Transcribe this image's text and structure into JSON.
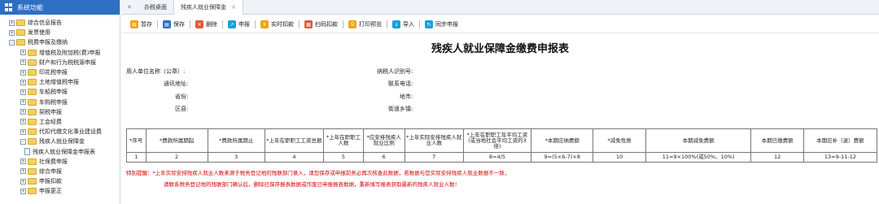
{
  "sidebar": {
    "title": "系统功能",
    "items": [
      {
        "label": "综合信息报告",
        "level": 0,
        "toggle": "+",
        "kind": "folder"
      },
      {
        "label": "发票使用",
        "level": 0,
        "toggle": "+",
        "kind": "folder"
      },
      {
        "label": "税费申报及缴纳",
        "level": 0,
        "toggle": "-",
        "kind": "folder"
      },
      {
        "label": "增值税及附加税(费)申报",
        "level": 1,
        "toggle": "+",
        "kind": "folder"
      },
      {
        "label": "财产和行为税税源申报",
        "level": 1,
        "toggle": "+",
        "kind": "folder"
      },
      {
        "label": "印花税申报",
        "level": 1,
        "toggle": "+",
        "kind": "folder"
      },
      {
        "label": "土地增值税申报",
        "level": 1,
        "toggle": "+",
        "kind": "folder"
      },
      {
        "label": "车船税申报",
        "level": 1,
        "toggle": "+",
        "kind": "folder"
      },
      {
        "label": "车购税申报",
        "level": 1,
        "toggle": "+",
        "kind": "folder"
      },
      {
        "label": "契税申报",
        "level": 1,
        "toggle": "+",
        "kind": "folder"
      },
      {
        "label": "工会经费",
        "level": 1,
        "toggle": "+",
        "kind": "folder"
      },
      {
        "label": "代扣代缴文化事业建设费",
        "level": 1,
        "toggle": "+",
        "kind": "folder"
      },
      {
        "label": "残疾人就业保障金",
        "level": 1,
        "toggle": "-",
        "kind": "folder"
      },
      {
        "label": "残疾人就业保障金申报表",
        "level": 2,
        "toggle": "",
        "kind": "doc"
      },
      {
        "label": "社保费申报",
        "level": 1,
        "toggle": "+",
        "kind": "folder"
      },
      {
        "label": "综合申报",
        "level": 1,
        "toggle": "+",
        "kind": "folder"
      },
      {
        "label": "申报扣款",
        "level": 1,
        "toggle": "+",
        "kind": "folder"
      },
      {
        "label": "申报更正",
        "level": 1,
        "toggle": "+",
        "kind": "folder"
      }
    ]
  },
  "tabs": {
    "nav_arrow": "«",
    "items": [
      {
        "label": "办税桌面"
      },
      {
        "label": "残疾人就业保障金",
        "close": "×"
      }
    ]
  },
  "toolbar": [
    {
      "label": "暂存",
      "color": "#f0a30a",
      "glyph": "▤"
    },
    {
      "label": "保存",
      "color": "#2e6fc4",
      "glyph": "▤"
    },
    {
      "label": "删除",
      "color": "#e15a3c",
      "glyph": "✕"
    },
    {
      "label": "申报",
      "color": "#1a9fd8",
      "glyph": "↗"
    },
    {
      "label": "实时扣款",
      "color": "#f0a30a",
      "glyph": "¥"
    },
    {
      "label": "扫码扣款",
      "color": "#e15a3c",
      "glyph": "▦"
    },
    {
      "label": "打印预览",
      "color": "#f0a30a",
      "glyph": "⎙"
    },
    {
      "label": "导入",
      "color": "#1a9fd8",
      "glyph": "↓"
    },
    {
      "label": "同步申报",
      "color": "#1a9fd8",
      "glyph": "↻"
    }
  ],
  "form": {
    "title": "残疾人就业保障金缴费申报表",
    "left_fields": [
      "用人单位名称（公章）:",
      "通讯地址:",
      "省份:",
      "区县:"
    ],
    "right_fields": [
      "纳税人识别号:",
      "联系电话:",
      "地市:",
      "街道乡镇:"
    ]
  },
  "table": {
    "headers": [
      "*序号",
      "*费款所属期起",
      "*费款所属期止",
      "*上年在职职工工资总额",
      "*上年在职职工人数",
      "*应安排残疾人就业比例",
      "*上年实际安排残疾人就业人数",
      "*上年在职职工年平均工资(或当地社会平均工资的3倍)",
      "*本期应纳费额",
      "*减免性质",
      "本期减免费额",
      "本期已缴费额",
      "本期应补（退）费额"
    ],
    "numbers": [
      "1",
      "2",
      "3",
      "4",
      "5",
      "6",
      "7",
      "8=4/5",
      "9=(5×6-7)×8",
      "10",
      "11=9×100%(或50%、10%)",
      "12",
      "13=9-11-12"
    ]
  },
  "notes": {
    "line1": "特别提醒：*上年实际安排残疾人就业人数来源于税务登记地的残联部门录入，请您保存或申报前务必再次核查此数据，若数据与您实际安排残疾人就业数据不一致，",
    "line2": "请联系税务登记地的残联部门确认后，删除已保存报表数据或作废已申报报表数据，重新填写报表获取最新的残疾人就业人数！"
  }
}
